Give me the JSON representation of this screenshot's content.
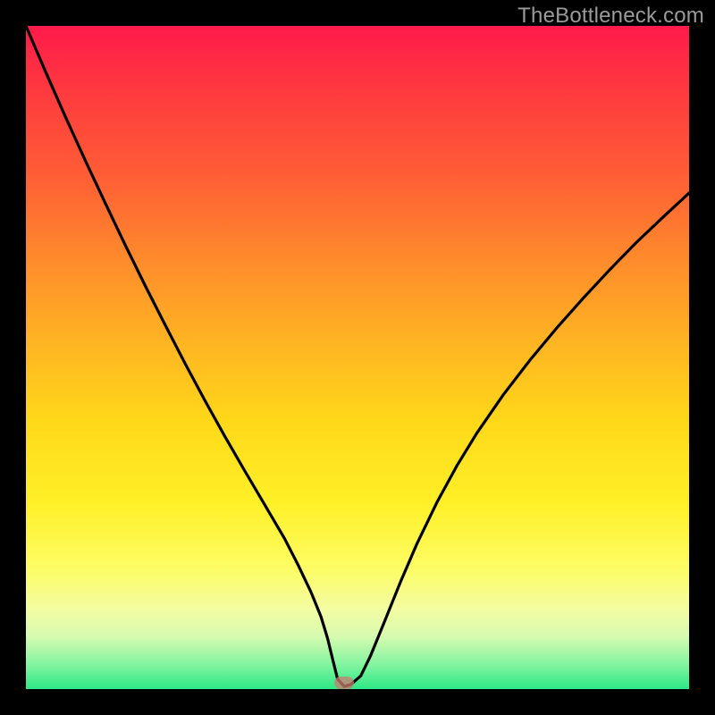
{
  "watermark": "TheBottleneck.com",
  "colors": {
    "frame": "#000000",
    "curve_stroke": "#000000",
    "marker_fill": "#c97b6f"
  },
  "chart_data": {
    "type": "line",
    "title": "",
    "xlabel": "",
    "ylabel": "",
    "xlim": [
      0,
      100
    ],
    "ylim": [
      0,
      100
    ],
    "grid": false,
    "x": [
      0,
      3,
      6,
      9,
      12,
      15,
      18,
      21,
      24,
      27,
      30,
      33,
      35,
      37,
      39,
      41,
      43,
      44.5,
      45.5,
      46.3,
      47,
      48,
      49,
      50.5,
      52,
      54,
      56.5,
      59,
      62,
      65,
      68,
      72,
      76,
      80,
      84,
      88,
      92,
      96,
      100
    ],
    "y": [
      100,
      93,
      86.2,
      79.6,
      73.2,
      66.9,
      60.8,
      54.9,
      49.1,
      43.5,
      38.1,
      32.9,
      29.5,
      26.1,
      22.7,
      18.8,
      14.6,
      10.9,
      7.6,
      4.3,
      1.5,
      0.4,
      0.7,
      2.0,
      5.1,
      10.0,
      16.2,
      22.0,
      28.2,
      33.7,
      38.6,
      44.4,
      49.6,
      54.4,
      58.9,
      63.2,
      67.3,
      71.1,
      74.8
    ],
    "marker": {
      "x": 48,
      "y": 1.0
    },
    "annotations": []
  }
}
